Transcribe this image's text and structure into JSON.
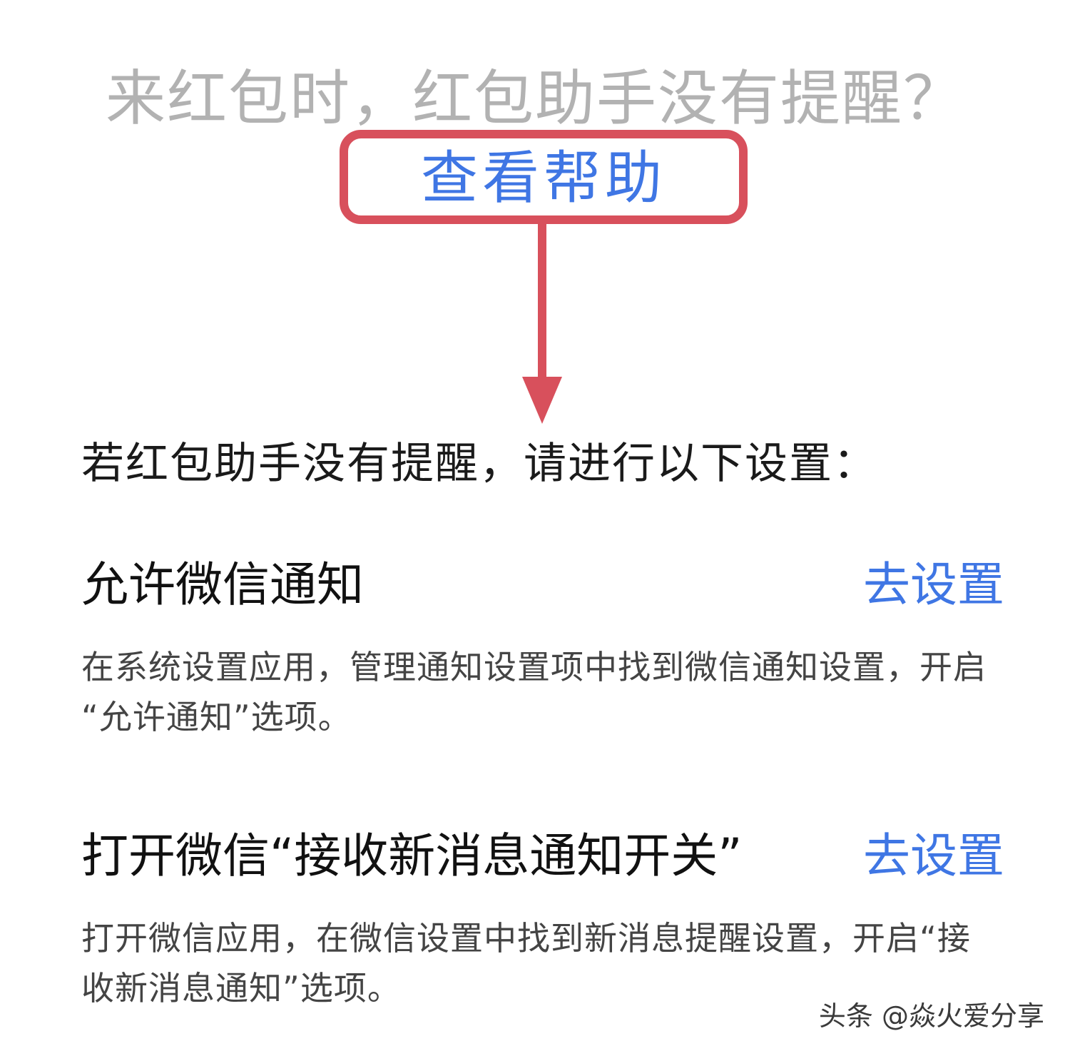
{
  "header": {
    "question": "来红包时，红包助手没有提醒？",
    "help_link": "查看帮助"
  },
  "intro": "若红包助手没有提醒，请进行以下设置：",
  "items": [
    {
      "title": "允许微信通知",
      "action": "去设置",
      "desc_line1": "在系统设置应用，管理通知设置项中找到微信通知设置，开启",
      "desc_line2": "“允许通知”选项。"
    },
    {
      "title": "打开微信“接收新消息通知开关”",
      "action": "去设置",
      "desc_line1": "打开微信应用，在微信设置中找到新消息提醒设置，开启“接",
      "desc_line2": "收新消息通知”选项。"
    }
  ],
  "watermark": "头条 @焱火爱分享",
  "colors": {
    "annotation_red": "#d8505c",
    "link_blue": "#3f76e4",
    "question_gray": "#b2b2b2"
  }
}
